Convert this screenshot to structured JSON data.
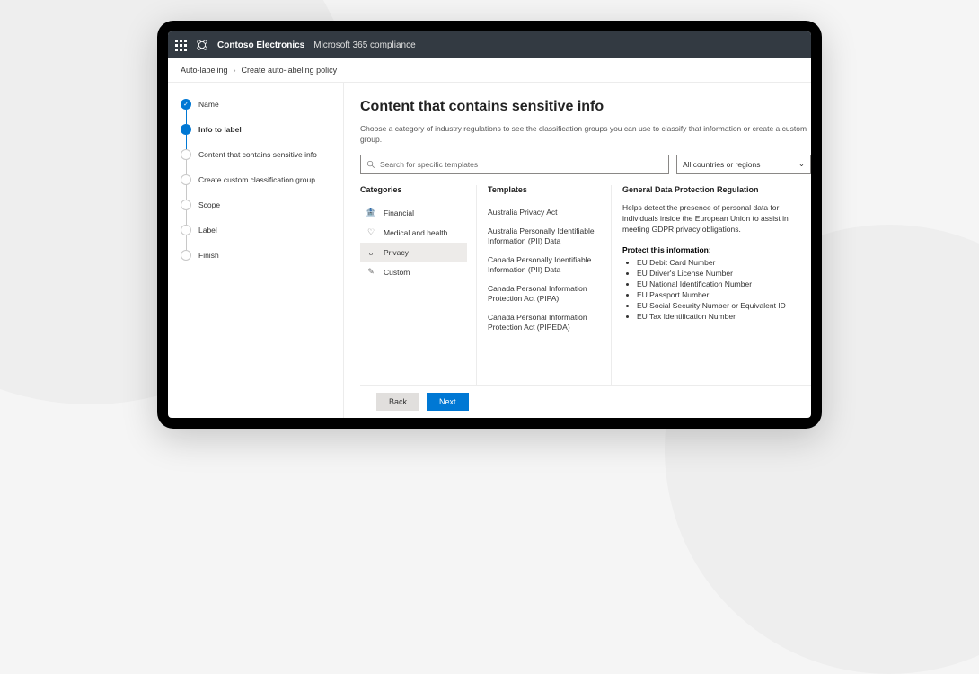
{
  "header": {
    "brand": "Contoso Electronics",
    "product": "Microsoft 365 compliance"
  },
  "breadcrumb": {
    "root": "Auto-labeling",
    "current": "Create auto-labeling policy"
  },
  "stepper": {
    "items": [
      {
        "label": "Name",
        "state": "done"
      },
      {
        "label": "Info to label",
        "state": "active"
      },
      {
        "label": "Content that contains sensitive info",
        "state": "pending"
      },
      {
        "label": "Create custom classification group",
        "state": "pending"
      },
      {
        "label": "Scope",
        "state": "pending"
      },
      {
        "label": "Label",
        "state": "pending"
      },
      {
        "label": "Finish",
        "state": "pending"
      }
    ]
  },
  "main": {
    "title": "Content that contains sensitive info",
    "subtitle": "Choose a category of industry regulations to see the classification groups you can use to classify that information or create a custom group.",
    "search_placeholder": "Search for specific templates",
    "region_selected": "All countries or regions"
  },
  "categories": {
    "heading": "Categories",
    "items": [
      {
        "icon": "bank-icon",
        "label": "Financial",
        "selected": false
      },
      {
        "icon": "medical-icon",
        "label": "Medical and health",
        "selected": false
      },
      {
        "icon": "privacy-icon",
        "label": "Privacy",
        "selected": true
      },
      {
        "icon": "custom-icon",
        "label": "Custom",
        "selected": false
      }
    ]
  },
  "templates": {
    "heading": "Templates",
    "items": [
      "Australia Privacy Act",
      "Australia Personally Identifiable Information (PII) Data",
      "Canada Personally Identifiable Information (PII) Data",
      "Canada Personal Information Protection Act (PIPA)",
      "Canada Personal Information Protection Act (PIPEDA)"
    ]
  },
  "detail": {
    "heading": "General Data Protection Regulation",
    "description": "Helps detect the presence of personal data for individuals inside the European Union to assist in meeting GDPR privacy obligations.",
    "protect_heading": "Protect this information:",
    "protect_items": [
      "EU Debit Card Number",
      "EU Driver's License Number",
      "EU National Identification Number",
      "EU Passport Number",
      "EU Social Security Number or Equivalent ID",
      "EU Tax Identification Number"
    ]
  },
  "footer": {
    "back": "Back",
    "next": "Next"
  }
}
